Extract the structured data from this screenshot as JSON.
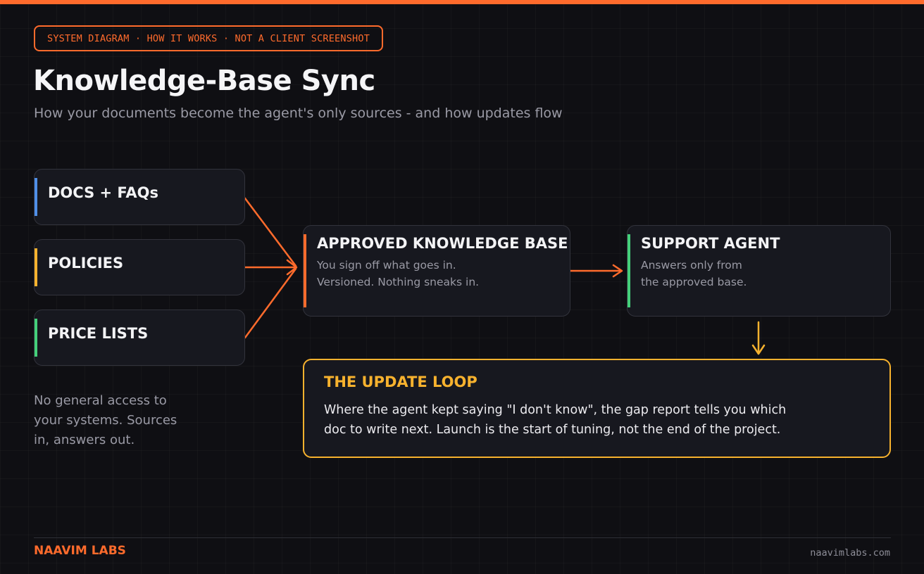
{
  "header": {
    "tag": "SYSTEM DIAGRAM · HOW IT WORKS · NOT A CLIENT SCREENSHOT",
    "title": "Knowledge-Base Sync",
    "subtitle": "How your documents become the agent's only sources - and how updates flow"
  },
  "sources": [
    {
      "label": "DOCS + FAQs",
      "color": "#4f8fe8"
    },
    {
      "label": "POLICIES",
      "color": "#f7b22e"
    },
    {
      "label": "PRICE LISTS",
      "color": "#44d07a"
    }
  ],
  "source_note": "No general access to your systems. Sources in, answers out.",
  "knowledge_base": {
    "title": "APPROVED KNOWLEDGE BASE",
    "line1": "You sign off what goes in.",
    "line2": "Versioned. Nothing sneaks in.",
    "color": "#ff6b2c"
  },
  "agent": {
    "title": "SUPPORT AGENT",
    "line1": "Answers only from",
    "line2": "the approved base.",
    "color": "#44d07a"
  },
  "update_loop": {
    "title": "THE UPDATE LOOP",
    "line1": "Where the agent kept saying \"I don't know\", the gap report tells you which",
    "line2": "doc to write next. Launch is the start of tuning, not the end of the project.",
    "color": "#f7b22e"
  },
  "footer": {
    "brand": "NAAVIM LABS",
    "url": "naavimlabs.com"
  },
  "colors": {
    "accent": "#ff6b2c",
    "background": "#0f0f13",
    "card": "#17181f"
  }
}
